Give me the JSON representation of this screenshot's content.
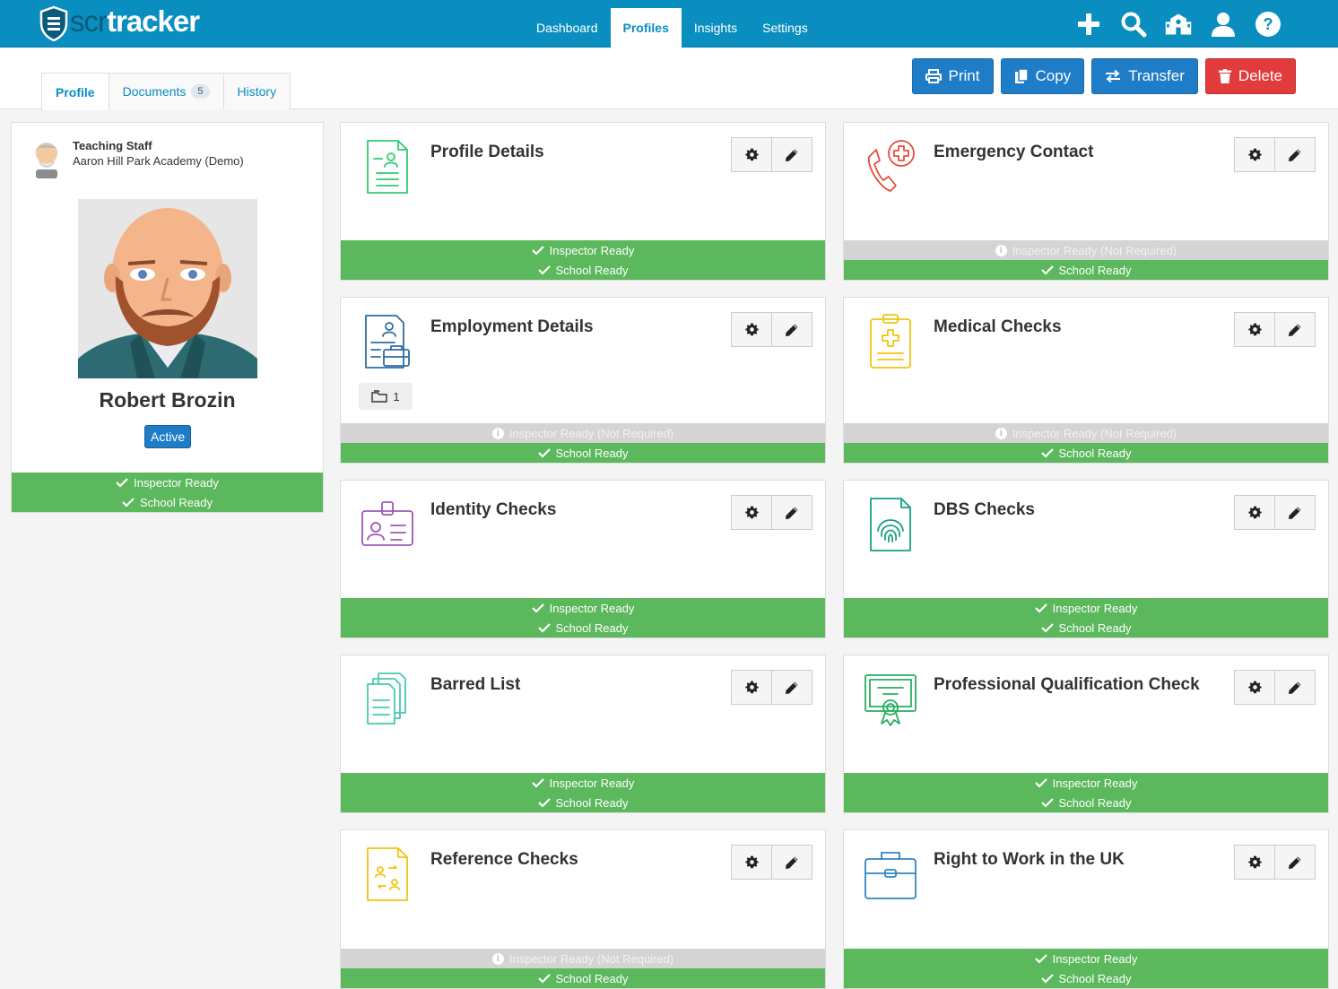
{
  "app": {
    "logo_text_a": "scr",
    "logo_text_b": "tracker"
  },
  "nav": {
    "links": [
      "Dashboard",
      "Profiles",
      "Insights",
      "Settings"
    ],
    "active": "Profiles",
    "icons": [
      "plus-icon",
      "search-icon",
      "school-icon",
      "user-icon",
      "help-icon"
    ]
  },
  "tabs": [
    {
      "label": "Profile",
      "badge": ""
    },
    {
      "label": "Documents",
      "badge": "5"
    },
    {
      "label": "History",
      "badge": ""
    }
  ],
  "actions": {
    "print": "Print",
    "copy": "Copy",
    "transfer": "Transfer",
    "delete": "Delete"
  },
  "profile": {
    "role": "Teaching Staff",
    "school": "Aaron Hill Park Academy (Demo)",
    "name": "Robert Brozin",
    "status": "Active",
    "inspector": "Inspector Ready",
    "school_ready": "School Ready"
  },
  "labels": {
    "inspector_ready": "Inspector Ready",
    "inspector_not_required": "Inspector Ready (Not Required)",
    "school_ready": "School Ready"
  },
  "cards": [
    {
      "title": "Profile Details",
      "icon": "document-person-icon",
      "color": "#2ecc71",
      "inspector": "ready",
      "doc_count": ""
    },
    {
      "title": "Emergency Contact",
      "icon": "phone-medical-icon",
      "color": "#e74c3c",
      "inspector": "not_required",
      "doc_count": ""
    },
    {
      "title": "Employment Details",
      "icon": "employment-document-icon",
      "color": "#2e6da4",
      "inspector": "not_required",
      "doc_count": "1"
    },
    {
      "title": "Medical Checks",
      "icon": "clipboard-medical-icon",
      "color": "#f1c40f",
      "inspector": "not_required",
      "doc_count": ""
    },
    {
      "title": "Identity Checks",
      "icon": "id-card-icon",
      "color": "#9b59b6",
      "inspector": "ready",
      "doc_count": ""
    },
    {
      "title": "DBS Checks",
      "icon": "fingerprint-document-icon",
      "color": "#16a085",
      "inspector": "ready",
      "doc_count": ""
    },
    {
      "title": "Barred List",
      "icon": "stacked-documents-icon",
      "color": "#48c9b0",
      "inspector": "ready",
      "doc_count": ""
    },
    {
      "title": "Professional Qualification Check",
      "icon": "certificate-icon",
      "color": "#27ae60",
      "inspector": "ready",
      "doc_count": ""
    },
    {
      "title": "Reference Checks",
      "icon": "reference-document-icon",
      "color": "#f1c40f",
      "inspector": "not_required",
      "doc_count": ""
    },
    {
      "title": "Right to Work in the UK",
      "icon": "briefcase-icon",
      "color": "#2e86c1",
      "inspector": "ready",
      "doc_count": ""
    }
  ]
}
